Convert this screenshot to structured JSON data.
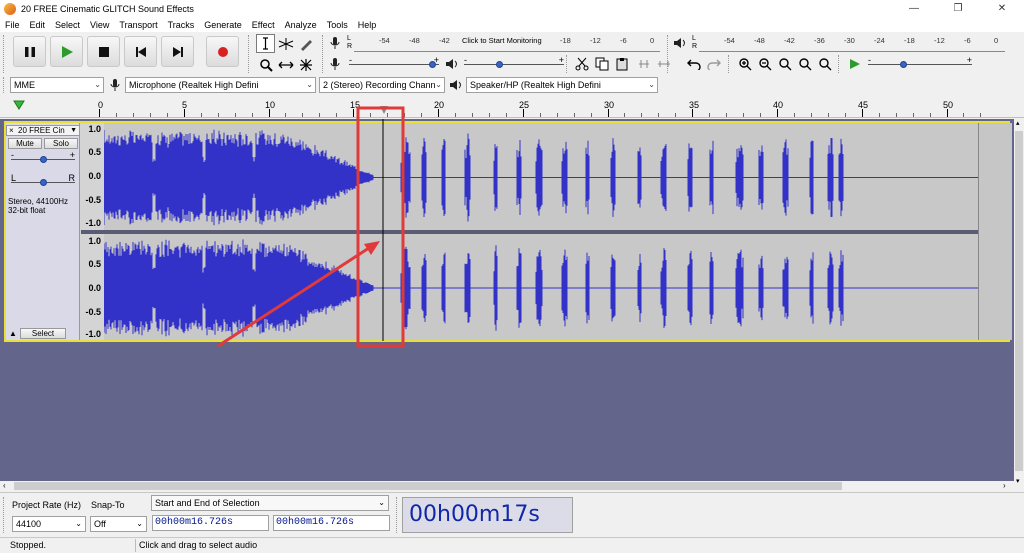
{
  "window": {
    "title": "20 FREE Cinematic GLITCH Sound Effects",
    "controls": {
      "minimize": "—",
      "maximize": "❐",
      "close": "✕"
    }
  },
  "menu": [
    "File",
    "Edit",
    "Select",
    "View",
    "Transport",
    "Tracks",
    "Generate",
    "Effect",
    "Analyze",
    "Tools",
    "Help"
  ],
  "transport": {
    "pause_icon": "pause-icon",
    "play_icon": "play-icon",
    "stop_icon": "stop-icon",
    "skip_start_icon": "skip-to-start-icon",
    "skip_end_icon": "skip-to-end-icon",
    "record_icon": "record-icon"
  },
  "meters": {
    "record_prompt": "Click to Start Monitoring",
    "record_scale": [
      "-54",
      "-48",
      "-42",
      "-18",
      "-12",
      "-6",
      "0"
    ],
    "play_scale": [
      "-54",
      "-48",
      "-42",
      "-36",
      "-30",
      "-24",
      "-18",
      "-12",
      "-6",
      "0"
    ],
    "channel_labels": [
      "L",
      "R"
    ]
  },
  "mixer": {
    "min_label": "-",
    "max_label": "+",
    "record_volume": 0.85,
    "play_volume": 0.35
  },
  "devices": {
    "host": "MME",
    "recording_device": "Microphone (Realtek High Defini",
    "channels": "2 (Stereo) Recording Chann",
    "playback_device": "Speaker/HP (Realtek High Defini"
  },
  "timeline": {
    "labels": [
      "0",
      "5",
      "10",
      "15",
      "20",
      "25",
      "30",
      "35",
      "40",
      "45",
      "50"
    ],
    "playhead_seconds": 16.726
  },
  "track": {
    "name": "20 FREE Cin",
    "close": "×",
    "menu_arrow": "▼",
    "mute": "Mute",
    "solo": "Solo",
    "gain_min": "-",
    "gain_max": "+",
    "pan_left": "L",
    "pan_right": "R",
    "info_line1": "Stereo, 44100Hz",
    "info_line2": "32-bit float",
    "select": "Select",
    "collapse": "▲",
    "amplitude_labels": [
      "1.0",
      "0.5",
      "0.0",
      "-0.5",
      "-1.0"
    ]
  },
  "selection_toolbar": {
    "project_rate_label": "Project Rate (Hz)",
    "snap_to_label": "Snap-To",
    "project_rate": "44100",
    "snap_to": "Off",
    "selection_mode": "Start and End of Selection",
    "start_time": "00h00m16.726s",
    "end_time": "00h00m16.726s",
    "audio_position": "00h00m17s"
  },
  "status": {
    "state": "Stopped.",
    "hint": "Click and drag to select audio"
  },
  "colors": {
    "waveform": "#3232c8",
    "track_background": "#c8c8c8",
    "tracks_area": "#63668a",
    "annotation_red": "#e03a3a",
    "time_digits": "#1126a9"
  }
}
